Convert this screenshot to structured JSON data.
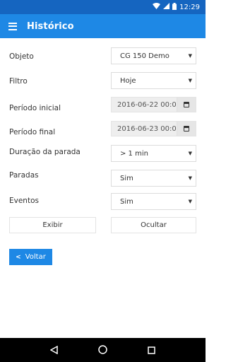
{
  "status_bar": {
    "time": "12:29"
  },
  "app_bar": {
    "title": "Histórico"
  },
  "form": {
    "objeto": {
      "label": "Objeto",
      "value": "CG 150 Demo"
    },
    "filtro": {
      "label": "Filtro",
      "value": "Hoje"
    },
    "periodo_inicial": {
      "label": "Período inicial",
      "value": "2016-06-22 00:00"
    },
    "periodo_final": {
      "label": "Período final",
      "value": "2016-06-23 00:00"
    },
    "duracao": {
      "label": "Duração da parada",
      "value": "> 1 min"
    },
    "paradas": {
      "label": "Paradas",
      "value": "Sim"
    },
    "eventos": {
      "label": "Eventos",
      "value": "Sim"
    }
  },
  "actions": {
    "exibir_label": "Exibir",
    "ocultar_label": "Ocultar",
    "voltar_label": "Voltar"
  },
  "colors": {
    "status_bar": "#1565c0",
    "app_bar": "#1e88e5",
    "primary_button": "#1e88e5",
    "nav_bar": "#000000"
  },
  "icons": [
    "wifi-icon",
    "signal-icon",
    "battery-icon",
    "menu-icon",
    "caret-down-icon",
    "calendar-icon",
    "chevron-left-icon",
    "nav-back-icon",
    "nav-home-icon",
    "nav-recents-icon"
  ]
}
